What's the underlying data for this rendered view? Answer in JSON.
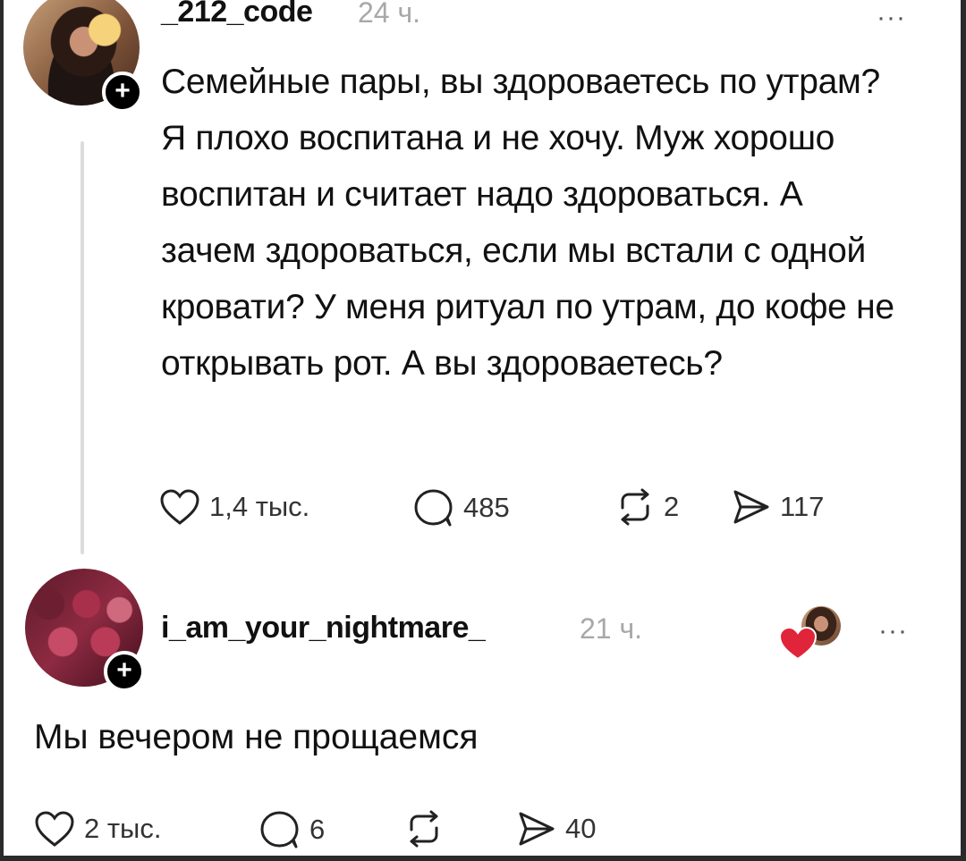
{
  "post": {
    "username": "_212_code",
    "time": "24 ч.",
    "more_label": "···",
    "text": "Семейные пары, вы здороваетесь по утрам? Я плохо воспитана и не хочу. Муж хорошо воспитан и считает надо здороваться. А зачем здороваться, если мы встали с одной кровати? У меня ритуал по утрам, до кофе не открывать рот. А вы здороваетесь?",
    "likes": "1,4 тыс.",
    "comments": "485",
    "reposts": "2",
    "shares": "117"
  },
  "reply": {
    "username": "i_am_your_nightmare_",
    "time": "21 ч.",
    "more_label": "···",
    "text": "Мы вечером не прощаемся",
    "likes": "2 тыс.",
    "comments": "6",
    "reposts": "",
    "shares": "40"
  },
  "plus_label": "+",
  "icons": {
    "like": "heart-outline-icon",
    "comment": "speech-bubble-icon",
    "repost": "repost-arrows-icon",
    "share": "send-arrow-icon",
    "liked_by_author": "red-heart-icon"
  },
  "colors": {
    "background": "#ffffff",
    "text": "#111111",
    "muted": "#a8a8a8",
    "heart": "#e0243a"
  }
}
